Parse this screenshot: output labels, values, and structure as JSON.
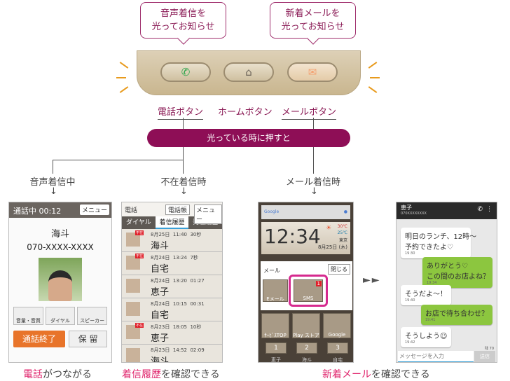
{
  "callouts": [
    {
      "text": "音声着信を\n光ってお知らせ"
    },
    {
      "text": "新着メールを\n光ってお知らせ"
    }
  ],
  "device": {
    "buttons": [
      {
        "icon": "phone-icon",
        "color": "#2aa54a"
      },
      {
        "icon": "home-icon",
        "color": "#6b6359"
      },
      {
        "icon": "mail-icon",
        "color": "#f4a070"
      }
    ]
  },
  "button_labels": {
    "phone": "電話ボタン",
    "home": "ホームボタン",
    "mail": "メールボタン"
  },
  "pill": "光っている時に押すと",
  "states": {
    "incoming": "音声着信中",
    "missed": "不在着信時",
    "mail": "メール着信時",
    "arrow": "↓"
  },
  "call_screen": {
    "status": "通話中 00:12",
    "menu": "メニュー",
    "name": "海斗",
    "number": "070-XXXX-XXXX",
    "buttons": [
      "音量・音質",
      "ダイヤル",
      "スピーカー"
    ],
    "end": "通話終了",
    "hold": "保 留"
  },
  "log_screen": {
    "title": "電話",
    "phonebook": "電話帳",
    "menu": "メニュー",
    "tabs": [
      "ダイヤル",
      "着信履歴",
      "発信履歴"
    ],
    "missed_badge": "不在",
    "entries": [
      {
        "date": "8月25日",
        "time": "11:40",
        "dur": "30秒",
        "name": "海斗",
        "missed": true
      },
      {
        "date": "8月24日",
        "time": "13:24",
        "dur": "7秒",
        "name": "自宅",
        "missed": true
      },
      {
        "date": "8月24日",
        "time": "13:20",
        "dur": "01:27",
        "name": "恵子",
        "missed": false
      },
      {
        "date": "8月24日",
        "time": "10:15",
        "dur": "00:31",
        "name": "自宅",
        "missed": false
      },
      {
        "date": "8月23日",
        "time": "18:05",
        "dur": "10秒",
        "name": "恵子",
        "missed": true
      },
      {
        "date": "8月23日",
        "time": "14:52",
        "dur": "02:09",
        "name": "海斗",
        "missed": false
      }
    ]
  },
  "home_screen": {
    "search": "Google",
    "clock": "12:34",
    "temp_high": "30℃",
    "temp_low": "25℃",
    "city": "東京",
    "date": "8月25日 (木)",
    "popup_title": "メール",
    "close": "閉じる",
    "apps": [
      "Eメール",
      "SMS"
    ],
    "sms_badge": "1",
    "dock": [
      "ｻｰﾋﾞｽTOP",
      "Play ストア",
      "Google"
    ],
    "speed_dial": [
      "1",
      "2",
      "3"
    ],
    "speed_names": [
      "恵子",
      "海斗",
      "自宅"
    ]
  },
  "sms_screen": {
    "name": "恵子",
    "number": "070XXXXXXXX",
    "counter": "残 70",
    "placeholder": "メッセージを入力",
    "send": "送信",
    "messages": [
      {
        "text": "明日のランチ、12時〜\n予約できたよ♡",
        "time": "19:30",
        "me": false
      },
      {
        "text": "ありがとう♡\nこの間のお店よね？",
        "time": "19:34",
        "me": true
      },
      {
        "text": "そうだよ〜！",
        "time": "19:40",
        "me": false
      },
      {
        "text": "お店で待ち合わせ？",
        "time": "19:41",
        "me": true
      },
      {
        "text": "そうしよう☺",
        "time": "19:42",
        "me": false
      }
    ]
  },
  "next_arrows": "►►",
  "captions": {
    "c1_em": "電話",
    "c1": "がつながる",
    "c2_em": "着信履歴",
    "c2": "を確認できる",
    "c3_em": "新着メール",
    "c3": "を確認できる"
  }
}
